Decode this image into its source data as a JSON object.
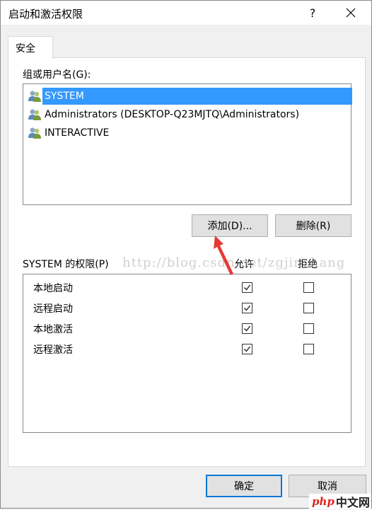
{
  "window": {
    "title": "启动和激活权限",
    "help_label": "?"
  },
  "tabs": [
    {
      "label": "安全"
    }
  ],
  "group_label": "组或用户名(G):",
  "users": [
    {
      "name": "SYSTEM",
      "selected": true,
      "icon": "users-icon"
    },
    {
      "name": "Administrators (DESKTOP-Q23MJTQ\\Administrators)",
      "selected": false,
      "icon": "users-icon"
    },
    {
      "name": "INTERACTIVE",
      "selected": false,
      "icon": "users-icon"
    }
  ],
  "buttons": {
    "add": "添加(D)...",
    "remove": "删除(R)",
    "ok": "确定",
    "cancel": "取消"
  },
  "permissions": {
    "label": "SYSTEM 的权限(P)",
    "allow_header": "允许",
    "deny_header": "拒绝",
    "rows": [
      {
        "name": "本地启动",
        "allow": true,
        "deny": false
      },
      {
        "name": "远程启动",
        "allow": true,
        "deny": false
      },
      {
        "name": "本地激活",
        "allow": true,
        "deny": false
      },
      {
        "name": "远程激活",
        "allow": true,
        "deny": false
      }
    ]
  },
  "watermark": "http://blog.csdn.net/zgjinchang",
  "logo": {
    "brand": "php",
    "suffix": "中文网"
  },
  "colors": {
    "selection": "#3399ff",
    "accent": "#0078d7",
    "arrow": "#e53935"
  }
}
